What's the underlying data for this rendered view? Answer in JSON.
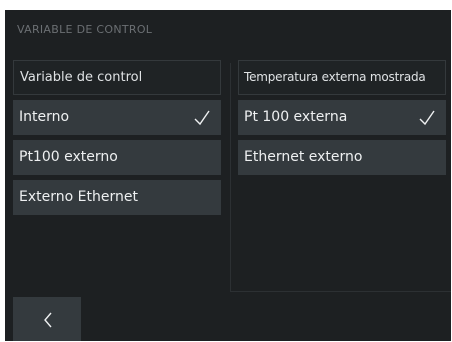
{
  "screen": {
    "title": "VARIABLE DE CONTROL"
  },
  "left_column": {
    "header": "Variable de control",
    "options": [
      {
        "label": "Interno",
        "selected": true
      },
      {
        "label": "Pt100 externo",
        "selected": false
      },
      {
        "label": "Externo Ethernet",
        "selected": false
      }
    ]
  },
  "right_column": {
    "header": "Temperatura externa mostrada",
    "options": [
      {
        "label": "Pt 100 externa",
        "selected": true
      },
      {
        "label": "Ethernet externo",
        "selected": false
      }
    ]
  },
  "icons": {
    "selected": "check-icon",
    "back": "chevron-left-icon"
  },
  "colors": {
    "background": "#1d2022",
    "option": "#343a3e",
    "text": "#eef0f1",
    "muted_title": "#6b6f73"
  }
}
